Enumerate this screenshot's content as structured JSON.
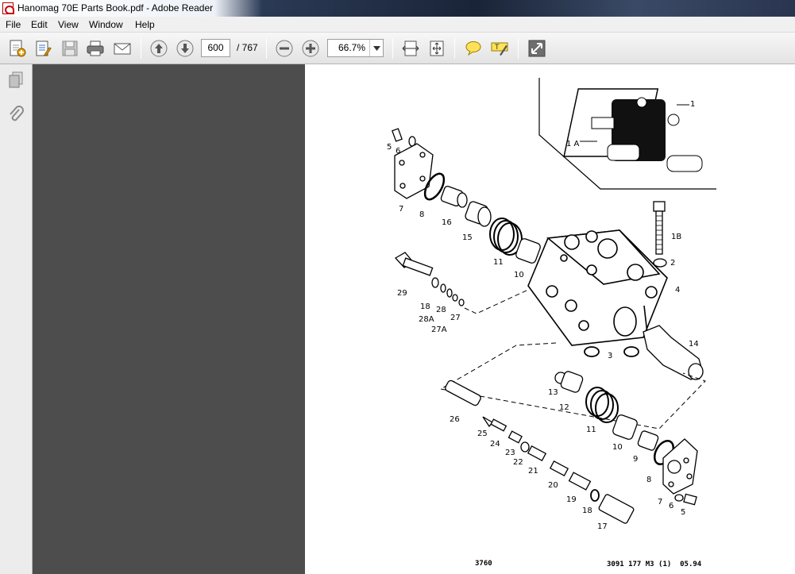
{
  "window": {
    "title": "Hanomag 70E Parts Book.pdf - Adobe Reader"
  },
  "menu": [
    "File",
    "Edit",
    "View",
    "Window",
    "Help"
  ],
  "toolbar": {
    "page_current": "600",
    "page_total": "/ 767",
    "zoom": "66.7%",
    "icons": [
      "create-pdf-icon",
      "edit-icon",
      "save-icon",
      "print-icon",
      "email-icon",
      "previous-page-icon",
      "next-page-icon",
      "zoom-out-icon",
      "zoom-in-icon",
      "fit-width-icon",
      "fit-page-icon",
      "comment-icon",
      "highlight-icon",
      "full-screen-icon"
    ]
  },
  "sidebar": {
    "icons": [
      "pages-icon",
      "attachments-icon"
    ]
  },
  "document": {
    "callouts": [
      "1",
      "1 A",
      "5",
      "6",
      "7",
      "8",
      "16",
      "15",
      "11",
      "10",
      "1B",
      "2",
      "4",
      "29",
      "18",
      "28A",
      "28",
      "27",
      "27A",
      "3",
      "14",
      "13",
      "12",
      "11",
      "26",
      "25",
      "24",
      "23",
      "22",
      "21",
      "10",
      "9",
      "8",
      "20",
      "19",
      "18",
      "17",
      "7",
      "6",
      "5"
    ],
    "footer_left": "3760",
    "footer_right": "3091 177 M3 (1)  05.94"
  }
}
